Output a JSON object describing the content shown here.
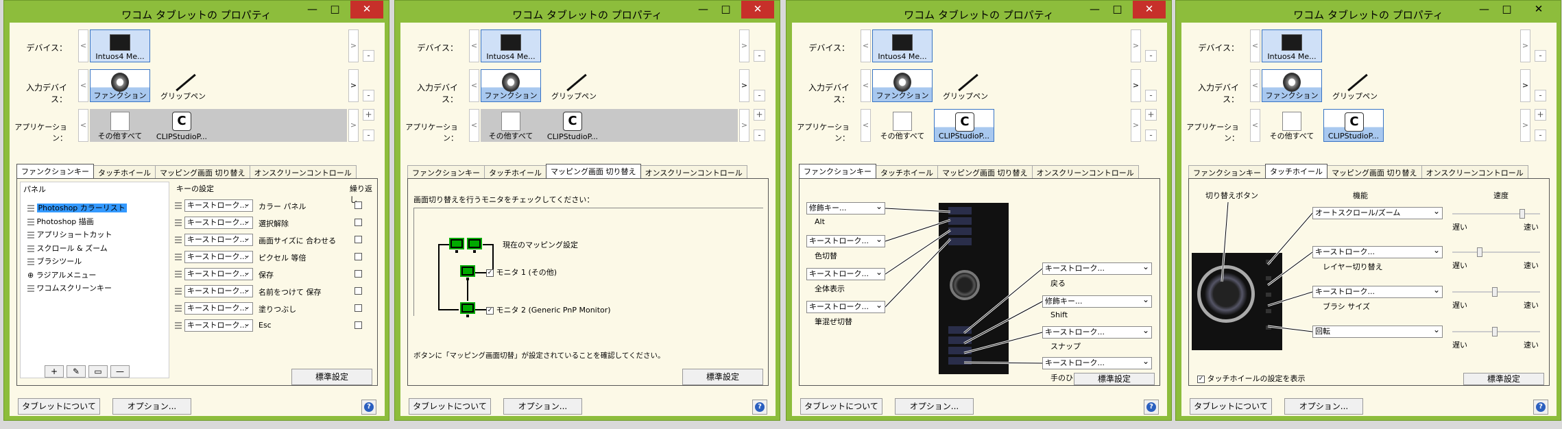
{
  "window_title": "ワコム タブレットの プロパティ",
  "titlebar": {
    "min": "—",
    "max": "□",
    "close": "✕"
  },
  "labels": {
    "device": "デバイス：",
    "input_device": "入力デバイス：",
    "application": "アプリケーション："
  },
  "tiles": {
    "device": "Intuos4 Me...",
    "function": "ファンクション",
    "grip_pen": "グリップペン",
    "all_other": "その他すべて",
    "clip": "CLIPStudioP..."
  },
  "tabs": [
    "ファンクションキー",
    "タッチホイール",
    "マッピング画面 切り替え",
    "オンスクリーンコントロール"
  ],
  "footer": {
    "about": "タブレットについて",
    "options": "オプション...",
    "default": "標準設定",
    "help": "?"
  },
  "arrows": {
    "left": "<",
    "right": ">",
    "minus": "-",
    "plus": "+"
  },
  "w1": {
    "panel_header": "パネル",
    "key_header": "キーの設定",
    "repeat_header": "繰り返し",
    "tree": [
      "Photoshop カラーリスト",
      "Photoshop 描画",
      "アプリショートカット",
      "スクロール & ズーム",
      "ブラシツール",
      "ラジアルメニュー",
      "ワコムスクリーンキー"
    ],
    "key_rows": [
      {
        "dd": "キーストローク...",
        "label": "カラー パネル"
      },
      {
        "dd": "キーストローク...",
        "label": "選択解除"
      },
      {
        "dd": "キーストローク...",
        "label": "画面サイズに 合わせる"
      },
      {
        "dd": "キーストローク...",
        "label": "ピクセル 等倍"
      },
      {
        "dd": "キーストローク...",
        "label": "保存"
      },
      {
        "dd": "キーストローク...",
        "label": "名前をつけて 保存"
      },
      {
        "dd": "キーストローク...",
        "label": "塗りつぶし"
      },
      {
        "dd": "キーストローク...",
        "label": "Esc"
      }
    ],
    "toolbar": [
      "+",
      "✎",
      "▭",
      "—"
    ]
  },
  "w2": {
    "instruction": "画面切り替えを行うモニタをチェックしてください：",
    "current": "現在のマッピング設定",
    "monitor1": "モニタ 1 (その他)",
    "monitor2": "モニタ 2 (Generic PnP Monitor)",
    "check": "✓",
    "note": "ボタンに「マッピング画面切替」が設定されていることを確認してください。"
  },
  "w3": {
    "left": [
      {
        "dd": "修飾キー...",
        "label": "Alt"
      },
      {
        "dd": "キーストローク...",
        "label": "色切替"
      },
      {
        "dd": "キーストローク...",
        "label": "全体表示"
      },
      {
        "dd": "キーストローク...",
        "label": "筆混ぜ切替"
      }
    ],
    "right": [
      {
        "dd": "キーストローク...",
        "label": "戻る"
      },
      {
        "dd": "修飾キー...",
        "label": "Shift"
      },
      {
        "dd": "キーストローク...",
        "label": "スナップ"
      },
      {
        "dd": "キーストローク...",
        "label": "手のひら"
      }
    ]
  },
  "w4": {
    "toggle_label": "切り替えボタン",
    "func_header": "機能",
    "speed_header": "速度",
    "rows": [
      {
        "dd": "オートスクロール/ズーム",
        "label": ""
      },
      {
        "dd": "キーストローク...",
        "label": "レイヤー切り替え"
      },
      {
        "dd": "キーストローク...",
        "label": "ブラシ サイズ"
      },
      {
        "dd": "回転",
        "label": ""
      }
    ],
    "slow": "遅い",
    "fast": "速い",
    "sliders": [
      0.82,
      0.3,
      0.48,
      0.48
    ],
    "show_settings": "タッチホイールの設定を表示"
  }
}
